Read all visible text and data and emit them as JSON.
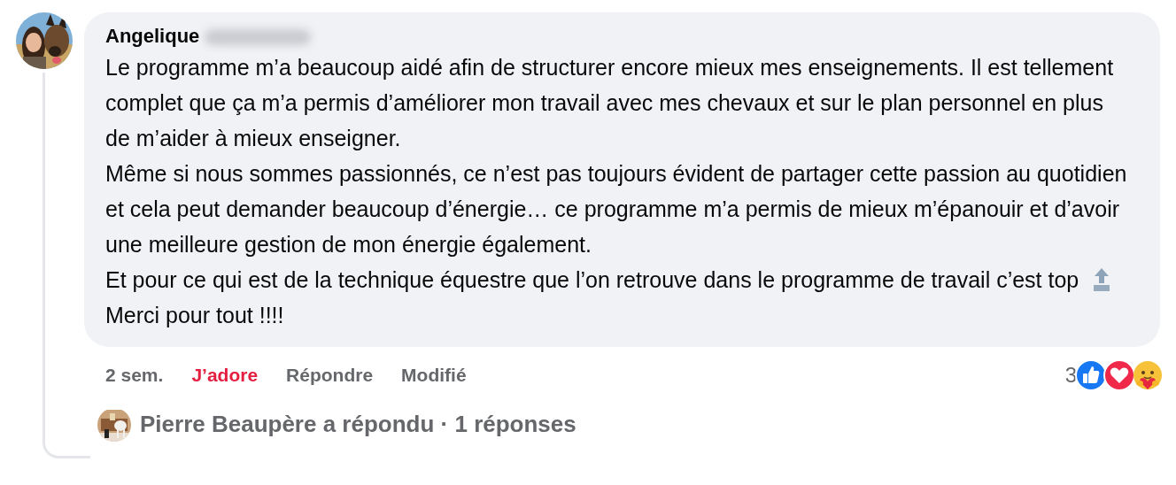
{
  "comment": {
    "author": "Angelique",
    "author_blurred": true,
    "body": [
      "Le programme m’a beaucoup aidé afin de structurer encore mieux mes enseignements. Il est tellement complet que ça m’a permis d’améliorer mon travail avec mes chevaux et sur le plan personnel en plus de m’aider à mieux enseigner.",
      "Même si nous sommes passionnés, ce n’est pas toujours évident de partager cette passion au quotidien et cela peut demander beaucoup d’énergie… ce programme m’a permis de mieux m’épanouir et d’avoir une meilleure gestion de mon énergie également.",
      "Et pour ce qui est de la technique équestre que l’on retrouve dans le programme de travail c’est top",
      "Merci pour tout !!!!"
    ],
    "time": "2 sem.",
    "actions": [
      {
        "label": "J’adore",
        "selected": true
      },
      {
        "label": "Répondre",
        "selected": false
      },
      {
        "label": "Modifié",
        "selected": false
      }
    ],
    "reaction_count": "3",
    "reactions": [
      {
        "kind": "like"
      },
      {
        "kind": "love"
      },
      {
        "kind": "care"
      }
    ]
  },
  "replies": {
    "text": "Pierre Beaupère a répondu · 1 réponses"
  }
}
